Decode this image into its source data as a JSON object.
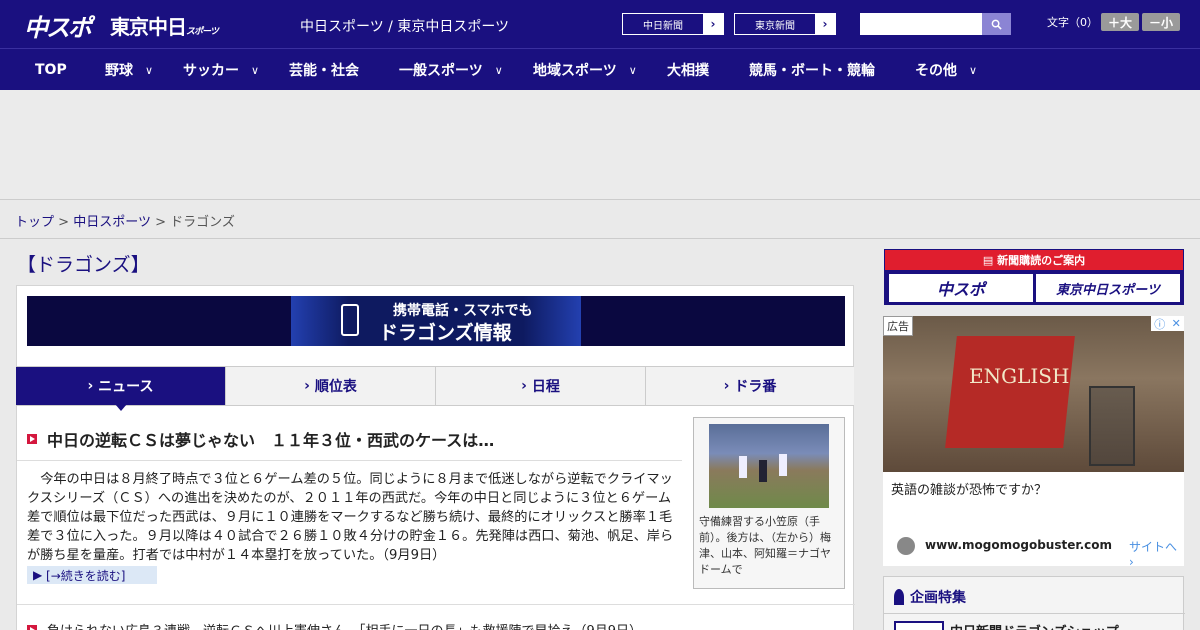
{
  "header": {
    "logo_main": "中スポ",
    "logo_tokyo": "東京中日",
    "logo_tokyo_sub": "スポーツ",
    "site_title": "中日スポーツ / 東京中日スポーツ",
    "link_chunichi": "中日新聞",
    "link_tokyo": "東京新聞",
    "search_placeholder": "",
    "font_label": "文字（0）",
    "font_large": "＋大",
    "font_small": "－小"
  },
  "nav": {
    "items": [
      {
        "label": "TOP"
      },
      {
        "label": "野球"
      },
      {
        "label": "サッカー"
      },
      {
        "label": "芸能・社会"
      },
      {
        "label": "一般スポーツ"
      },
      {
        "label": "地域スポーツ"
      },
      {
        "label": "大相撲"
      },
      {
        "label": "競馬・ボート・競輪"
      },
      {
        "label": "その他"
      }
    ]
  },
  "breadcrumb": {
    "top": "トップ",
    "sep": ">",
    "chunichi_sports": "中日スポーツ",
    "current": "ドラゴンズ"
  },
  "main": {
    "heading": "【ドラゴンズ】",
    "banner_line1": "携帯電話・スマホでも",
    "banner_line2": "ドラゴンズ情報",
    "tabs": [
      {
        "label": "ニュース",
        "active": true
      },
      {
        "label": "順位表",
        "active": false
      },
      {
        "label": "日程",
        "active": false
      },
      {
        "label": "ドラ番",
        "active": false
      }
    ],
    "article": {
      "title": "中日の逆転ＣＳは夢じゃない　１１年３位・西武のケースは…",
      "body": "今年の中日は８月終了時点で３位と６ゲーム差の５位。同じように８月まで低迷しながら逆転でクライマックスシリーズ（ＣＳ）への進出を決めたのが、２０１１年の西武だ。今年の中日と同じように３位と６ゲーム差で順位は最下位だった西武は、９月に１０連勝をマークするなど勝ち続け、最終的にオリックスと勝率１毛差で３位に入った。９月以降は４０試合で２６勝１０敗４分けの貯金１６。先発陣は西口、菊池、帆足、岸らが勝ち星を量産。打者では中村が１４本塁打を放っていた。（9月9日）",
      "readmore": "[→続きを読む]",
      "photo_caption": "守備練習する小笠原（手前）。後方は、（左から）梅津、山本、阿知羅＝ナゴヤドームで"
    },
    "list_item": "負けられない広島３連戦　逆転ＣＳへ川上憲伸さん　「相手に一日の長」も救援陣で早拾え（9月9日）"
  },
  "sidebar": {
    "subscribe_head": "新聞購読のご案内",
    "subscribe_chuspo": "中スポ",
    "subscribe_tokyo": "東京中日スポーツ",
    "ad_label": "広告",
    "ad_book_text": "ENGLISH",
    "ad_text": "英語の雑談が恐怖ですか？",
    "ad_domain": "www.mogomogobuster.com",
    "ad_site_link": "サイトへ",
    "feature_head": "企画特集",
    "feature_item": "中日新聞ドラゴンズショップ"
  },
  "colors": {
    "brand_navy": "#1a1080",
    "accent_red": "#d4173e"
  }
}
